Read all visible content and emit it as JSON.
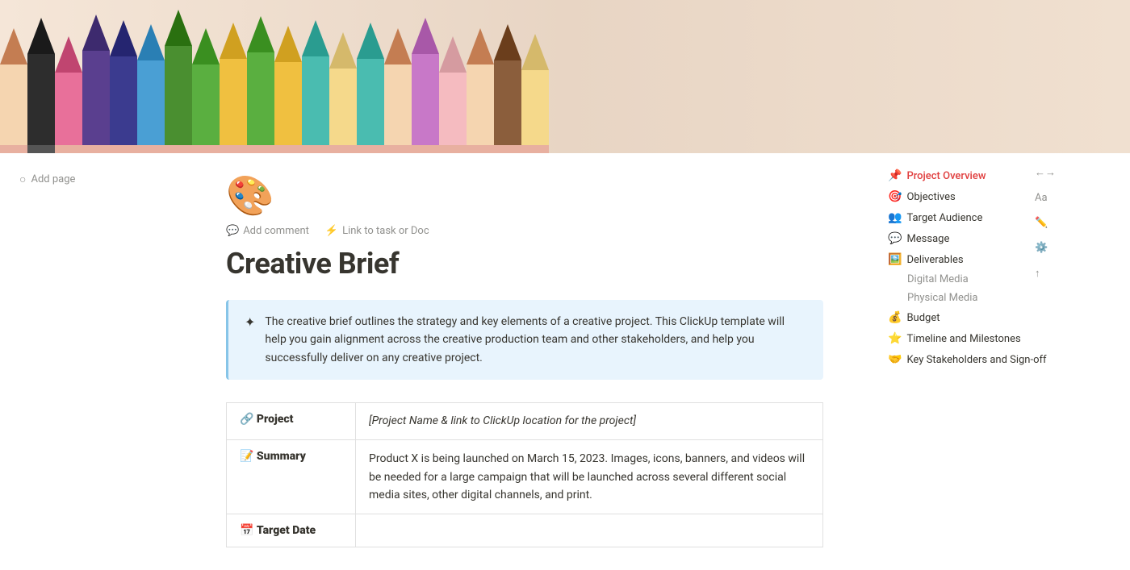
{
  "hero": {
    "pencils": [
      {
        "color": "#e8a87c",
        "tip_color": "#c47d52"
      },
      {
        "color": "#2d2d2d",
        "tip_color": "#1a1a1a"
      },
      {
        "color": "#e8709a",
        "tip_color": "#c04570"
      },
      {
        "color": "#5a3f8f",
        "tip_color": "#3d2a6e"
      },
      {
        "color": "#3b3b8f",
        "tip_color": "#252570"
      },
      {
        "color": "#4a9fd4",
        "tip_color": "#2a7fb4"
      },
      {
        "color": "#6ab04c",
        "tip_color": "#4a9030"
      },
      {
        "color": "#6ab04c",
        "tip_color": "#4a9030"
      },
      {
        "color": "#f0c040",
        "tip_color": "#d0a020"
      },
      {
        "color": "#6ab04c",
        "tip_color": "#4a9030"
      },
      {
        "color": "#f0c040",
        "tip_color": "#d0a020"
      },
      {
        "color": "#4abcb0",
        "tip_color": "#2a9c90"
      },
      {
        "color": "#f5d98b",
        "tip_color": "#d5b96b"
      },
      {
        "color": "#4abcb0",
        "tip_color": "#2a9c90"
      },
      {
        "color": "#e8a87c",
        "tip_color": "#c47d52"
      },
      {
        "color": "#c878c8",
        "tip_color": "#a858a8"
      },
      {
        "color": "#f5bbc0",
        "tip_color": "#d59ba0"
      },
      {
        "color": "#e8a87c",
        "tip_color": "#c47d52"
      },
      {
        "color": "#8b5e3c",
        "tip_color": "#6b3e1c"
      },
      {
        "color": "#f5d98b",
        "tip_color": "#d5b96b"
      }
    ]
  },
  "left_sidebar": {
    "add_page_label": "Add page"
  },
  "toolbar": {
    "add_comment_label": "Add comment",
    "link_to_task_label": "Link to task or Doc"
  },
  "page": {
    "icon": "🎨",
    "title": "Creative Brief",
    "info_text": "The creative brief outlines the strategy and key elements of a creative project. This ClickUp template will help you gain alignment across the creative production team and other stakeholders, and help you successfully deliver on any creative project.",
    "info_icon": "✦"
  },
  "table": {
    "rows": [
      {
        "label_icon": "🔗",
        "label": "Project",
        "value": "[Project Name & link to ClickUp location for the project]",
        "value_style": "italic"
      },
      {
        "label_icon": "📝",
        "label": "Summary",
        "value": "Product X is being launched on March 15, 2023. Images, icons, banners, and videos will be needed for a large campaign that will be launched across several different social media sites, other digital channels, and print.",
        "value_style": "normal"
      },
      {
        "label_icon": "📅",
        "label": "Target Date",
        "value": "",
        "value_style": "normal"
      }
    ]
  },
  "toc": {
    "items": [
      {
        "emoji": "📌",
        "label": "Project Overview",
        "active": true,
        "color": "#e03e3e"
      },
      {
        "emoji": "🎯",
        "label": "Objectives",
        "active": false,
        "color": ""
      },
      {
        "emoji": "👥",
        "label": "Target Audience",
        "active": false,
        "color": ""
      },
      {
        "emoji": "💬",
        "label": "Message",
        "active": false,
        "color": ""
      },
      {
        "emoji": "🖼️",
        "label": "Deliverables",
        "active": false,
        "color": ""
      },
      {
        "emoji": "💰",
        "label": "Budget",
        "active": false,
        "color": ""
      },
      {
        "emoji": "⭐",
        "label": "Timeline and Milestones",
        "active": false,
        "color": ""
      },
      {
        "emoji": "🤝",
        "label": "Key Stakeholders and Sign-off",
        "active": false,
        "color": ""
      }
    ],
    "sub_items": [
      {
        "label": "Digital Media"
      },
      {
        "label": "Physical Media"
      }
    ]
  }
}
